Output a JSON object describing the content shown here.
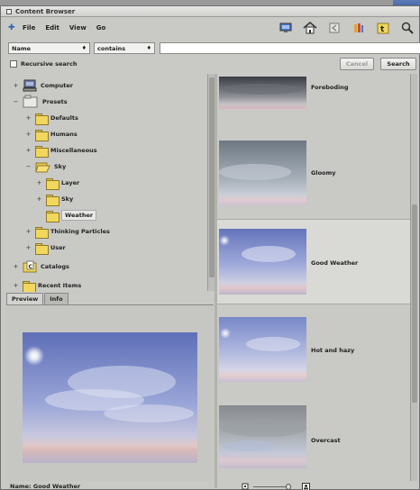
{
  "window": {
    "title": "Content Browser"
  },
  "menu": {
    "items": [
      "File",
      "Edit",
      "View",
      "Go"
    ]
  },
  "toolbar": {
    "icons": [
      "desktop-icon",
      "home-icon",
      "back-icon",
      "forward-icon",
      "catalog-icon",
      "search-icon"
    ]
  },
  "filter": {
    "field_value": "Name",
    "operator_value": "contains",
    "text_value": ""
  },
  "options": {
    "recursive_label": "Recursive search",
    "recursive_checked": false,
    "cancel_label": "Cancel",
    "search_label": "Search"
  },
  "tree": {
    "items": [
      {
        "label": "Computer",
        "level": 0,
        "expanded": false
      },
      {
        "label": "Presets",
        "level": 0,
        "expanded": true
      },
      {
        "label": "Defaults",
        "level": 1,
        "expanded": false
      },
      {
        "label": "Humans",
        "level": 1,
        "expanded": false
      },
      {
        "label": "Miscellaneous",
        "level": 1,
        "expanded": false
      },
      {
        "label": "Sky",
        "level": 1,
        "expanded": true
      },
      {
        "label": "Layer",
        "level": 2,
        "expanded": false
      },
      {
        "label": "Sky",
        "level": 2,
        "expanded": false
      },
      {
        "label": "Weather",
        "level": 2,
        "selected": true
      },
      {
        "label": "Thinking Particles",
        "level": 1,
        "expanded": false
      },
      {
        "label": "User",
        "level": 1,
        "expanded": false
      },
      {
        "label": "Catalogs",
        "level": 0,
        "expanded": false
      },
      {
        "label": "Recent Items",
        "level": 0,
        "expanded": false
      }
    ]
  },
  "preview": {
    "tabs": [
      "Preview",
      "Info"
    ],
    "active_tab": "Preview",
    "name_label": "Name:",
    "name_value": "Good Weather"
  },
  "list": {
    "items": [
      {
        "label": "Foreboding",
        "style": "dark"
      },
      {
        "label": "Gloomy",
        "style": "gray"
      },
      {
        "label": "Good Weather",
        "style": "blue",
        "selected": true
      },
      {
        "label": "Hot and hazy",
        "style": "bright"
      },
      {
        "label": "Overcast",
        "style": "overcast"
      }
    ]
  },
  "colors": {
    "window_bg": "#c9c9c6",
    "folder_yellow": "#f1d75c",
    "sky_blue": "#7d8dc8"
  }
}
